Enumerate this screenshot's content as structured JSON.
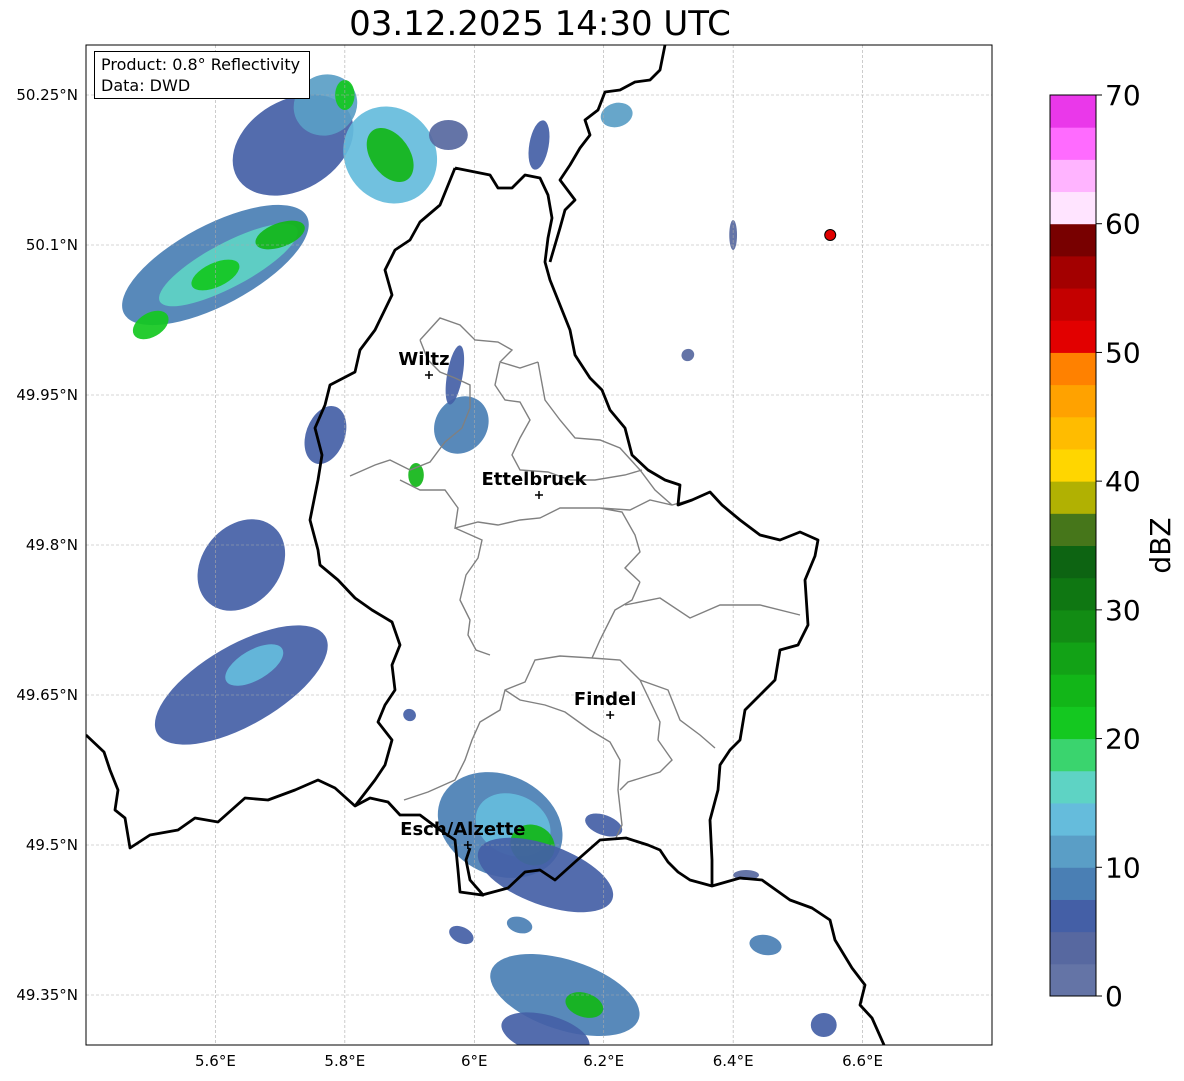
{
  "title": "03.12.2025 14:30 UTC",
  "info": {
    "product": "Product: 0.8° Reflectivity",
    "data": "Data: DWD"
  },
  "map": {
    "lon_range": [
      5.4,
      6.8
    ],
    "lat_range": [
      49.3,
      50.3
    ],
    "lon_ticks": [
      {
        "value": 5.6,
        "label": "5.6°E"
      },
      {
        "value": 5.8,
        "label": "5.8°E"
      },
      {
        "value": 6.0,
        "label": "6°E"
      },
      {
        "value": 6.2,
        "label": "6.2°E"
      },
      {
        "value": 6.4,
        "label": "6.4°E"
      },
      {
        "value": 6.6,
        "label": "6.6°E"
      }
    ],
    "lat_ticks": [
      {
        "value": 50.25,
        "label": "50.25°N"
      },
      {
        "value": 50.1,
        "label": "50.1°N"
      },
      {
        "value": 49.95,
        "label": "49.95°N"
      },
      {
        "value": 49.8,
        "label": "49.8°N"
      },
      {
        "value": 49.65,
        "label": "49.65°N"
      },
      {
        "value": 49.5,
        "label": "49.5°N"
      },
      {
        "value": 49.35,
        "label": "49.35°N"
      }
    ],
    "grid": true,
    "cities": [
      {
        "name": "Wiltz",
        "lon": 5.93,
        "lat": 49.97
      },
      {
        "name": "Ettelbruck",
        "lon": 6.1,
        "lat": 49.85
      },
      {
        "name": "Findel",
        "lon": 6.21,
        "lat": 49.63
      },
      {
        "name": "Esch/Alzette",
        "lon": 5.99,
        "lat": 49.5
      }
    ],
    "radar_site": {
      "lon": 6.55,
      "lat": 50.11,
      "color": "#e00000"
    },
    "reflectivity_cells": [
      {
        "lon": 5.72,
        "lat": 50.2,
        "rx": 0.1,
        "ry": 0.045,
        "dbz": 6,
        "angle": -30
      },
      {
        "lon": 5.87,
        "lat": 50.19,
        "rx": 0.07,
        "ry": 0.05,
        "dbz": 14,
        "angle": -35
      },
      {
        "lon": 5.87,
        "lat": 50.19,
        "rx": 0.03,
        "ry": 0.03,
        "dbz": 24,
        "angle": -35
      },
      {
        "lon": 5.77,
        "lat": 50.24,
        "rx": 0.05,
        "ry": 0.03,
        "dbz": 12,
        "angle": -30
      },
      {
        "lon": 5.8,
        "lat": 50.25,
        "rx": 0.015,
        "ry": 0.015,
        "dbz": 22,
        "angle": 0
      },
      {
        "lon": 5.6,
        "lat": 50.08,
        "rx": 0.16,
        "ry": 0.04,
        "dbz": 8,
        "angle": -28
      },
      {
        "lon": 5.62,
        "lat": 50.08,
        "rx": 0.12,
        "ry": 0.022,
        "dbz": 16,
        "angle": -28
      },
      {
        "lon": 5.7,
        "lat": 50.11,
        "rx": 0.04,
        "ry": 0.012,
        "dbz": 24,
        "angle": -20
      },
      {
        "lon": 5.6,
        "lat": 50.07,
        "rx": 0.04,
        "ry": 0.012,
        "dbz": 22,
        "angle": -25
      },
      {
        "lon": 5.5,
        "lat": 50.02,
        "rx": 0.03,
        "ry": 0.012,
        "dbz": 22,
        "angle": -30
      },
      {
        "lon": 5.96,
        "lat": 50.21,
        "rx": 0.03,
        "ry": 0.015,
        "dbz": 4,
        "angle": 0
      },
      {
        "lon": 6.1,
        "lat": 50.2,
        "rx": 0.015,
        "ry": 0.025,
        "dbz": 5,
        "angle": 10
      },
      {
        "lon": 6.22,
        "lat": 50.23,
        "rx": 0.025,
        "ry": 0.012,
        "dbz": 10,
        "angle": -15
      },
      {
        "lon": 6.4,
        "lat": 50.11,
        "rx": 0.006,
        "ry": 0.015,
        "dbz": 4,
        "angle": 0
      },
      {
        "lon": 6.33,
        "lat": 49.99,
        "rx": 0.01,
        "ry": 0.006,
        "dbz": 4,
        "angle": -30
      },
      {
        "lon": 5.98,
        "lat": 49.92,
        "rx": 0.04,
        "ry": 0.03,
        "dbz": 8,
        "angle": 35
      },
      {
        "lon": 5.91,
        "lat": 49.87,
        "rx": 0.012,
        "ry": 0.012,
        "dbz": 24,
        "angle": 0
      },
      {
        "lon": 5.97,
        "lat": 49.97,
        "rx": 0.012,
        "ry": 0.03,
        "dbz": 5,
        "angle": 10
      },
      {
        "lon": 5.77,
        "lat": 49.91,
        "rx": 0.03,
        "ry": 0.03,
        "dbz": 6,
        "angle": 20
      },
      {
        "lon": 5.64,
        "lat": 49.78,
        "rx": 0.06,
        "ry": 0.05,
        "dbz": 6,
        "angle": 40
      },
      {
        "lon": 5.64,
        "lat": 49.66,
        "rx": 0.15,
        "ry": 0.04,
        "dbz": 6,
        "angle": -30
      },
      {
        "lon": 5.66,
        "lat": 49.68,
        "rx": 0.05,
        "ry": 0.015,
        "dbz": 14,
        "angle": -30
      },
      {
        "lon": 6.04,
        "lat": 49.52,
        "rx": 0.1,
        "ry": 0.05,
        "dbz": 8,
        "angle": 25
      },
      {
        "lon": 6.06,
        "lat": 49.52,
        "rx": 0.06,
        "ry": 0.03,
        "dbz": 14,
        "angle": 25
      },
      {
        "lon": 6.09,
        "lat": 49.5,
        "rx": 0.035,
        "ry": 0.02,
        "dbz": 24,
        "angle": 25
      },
      {
        "lon": 6.11,
        "lat": 49.47,
        "rx": 0.11,
        "ry": 0.03,
        "dbz": 6,
        "angle": 20
      },
      {
        "lon": 6.2,
        "lat": 49.52,
        "rx": 0.03,
        "ry": 0.01,
        "dbz": 5,
        "angle": 20
      },
      {
        "lon": 6.14,
        "lat": 49.35,
        "rx": 0.12,
        "ry": 0.035,
        "dbz": 8,
        "angle": 18
      },
      {
        "lon": 6.17,
        "lat": 49.34,
        "rx": 0.03,
        "ry": 0.012,
        "dbz": 24,
        "angle": 18
      },
      {
        "lon": 6.11,
        "lat": 49.31,
        "rx": 0.07,
        "ry": 0.02,
        "dbz": 6,
        "angle": 15
      },
      {
        "lon": 5.98,
        "lat": 49.41,
        "rx": 0.02,
        "ry": 0.008,
        "dbz": 5,
        "angle": 25
      },
      {
        "lon": 6.07,
        "lat": 49.42,
        "rx": 0.02,
        "ry": 0.008,
        "dbz": 8,
        "angle": 15
      },
      {
        "lon": 6.45,
        "lat": 49.4,
        "rx": 0.025,
        "ry": 0.01,
        "dbz": 8,
        "angle": 10
      },
      {
        "lon": 6.54,
        "lat": 49.32,
        "rx": 0.02,
        "ry": 0.012,
        "dbz": 5,
        "angle": 0
      },
      {
        "lon": 6.42,
        "lat": 49.47,
        "rx": 0.02,
        "ry": 0.005,
        "dbz": 4,
        "angle": 0
      },
      {
        "lon": 5.9,
        "lat": 49.63,
        "rx": 0.01,
        "ry": 0.006,
        "dbz": 5,
        "angle": 30
      }
    ]
  },
  "colorbar": {
    "label": "dBZ",
    "min": 0,
    "max": 70,
    "ticks": [
      {
        "value": 0,
        "label": "0"
      },
      {
        "value": 10,
        "label": "10"
      },
      {
        "value": 20,
        "label": "20"
      },
      {
        "value": 30,
        "label": "30"
      },
      {
        "value": 40,
        "label": "40"
      },
      {
        "value": 50,
        "label": "50"
      },
      {
        "value": 60,
        "label": "60"
      },
      {
        "value": 70,
        "label": "70"
      }
    ],
    "colors": [
      "#6474a6",
      "#5768a0",
      "#445fa6",
      "#4a7fb4",
      "#5a9ec6",
      "#65bcdc",
      "#5ed3c4",
      "#3ad46e",
      "#14c820",
      "#12b618",
      "#12a216",
      "#128c14",
      "#0f7712",
      "#0d6412",
      "#46761a",
      "#b1b102",
      "#ffd600",
      "#ffbc00",
      "#ffa200",
      "#ff8100",
      "#e20000",
      "#c40000",
      "#a30000",
      "#780000",
      "#ffe4ff",
      "#ffb4ff",
      "#ff6bff",
      "#ea38ea"
    ]
  }
}
